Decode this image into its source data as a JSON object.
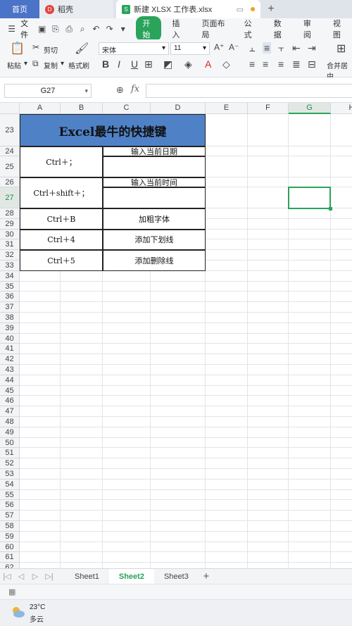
{
  "tabs": {
    "home": "首页",
    "docer": "稻壳",
    "file": "新建 XLSX 工作表.xlsx",
    "add_icon": "plus-icon"
  },
  "menu": {
    "file": "文件",
    "start": "开始",
    "items": [
      "插入",
      "页面布局",
      "公式",
      "数据",
      "审阅",
      "视图"
    ]
  },
  "ribbon": {
    "paste": "粘贴",
    "cut": "剪切",
    "copy": "复制",
    "format_painter": "格式刷",
    "font_name": "宋体",
    "font_size": "11",
    "merge": "合并居中"
  },
  "formula_bar": {
    "cell_ref": "G27",
    "fx": "fx",
    "value": ""
  },
  "columns": [
    "A",
    "B",
    "C",
    "D",
    "E",
    "F",
    "G",
    "H"
  ],
  "selected_column": "G",
  "selected_row": "27",
  "rows": [
    "23",
    "24",
    "25",
    "26",
    "27",
    "28",
    "29",
    "30",
    "31",
    "32",
    "33",
    "34",
    "35",
    "36",
    "37",
    "38",
    "39",
    "40",
    "41",
    "42",
    "43",
    "44",
    "45",
    "46",
    "47",
    "48",
    "49",
    "50",
    "51",
    "52",
    "53",
    "54",
    "55",
    "56",
    "57",
    "58",
    "59",
    "60",
    "61",
    "62"
  ],
  "table": {
    "title": "Excel最牛的快捷键",
    "entries": [
      {
        "key": "Ctrl＋；",
        "desc": "输入当前日期"
      },
      {
        "key": "Ctrl＋shift＋；",
        "desc": "输入当前时间"
      },
      {
        "key": "Ctrl＋B",
        "desc": "加粗字体"
      },
      {
        "key": "Ctrl＋4",
        "desc": "添加下划线"
      },
      {
        "key": "Ctrl＋5",
        "desc": "添加删除线"
      }
    ]
  },
  "sheets": [
    "Sheet1",
    "Sheet2",
    "Sheet3"
  ],
  "active_sheet": "Sheet2",
  "weather": {
    "temp": "23°C",
    "condition": "多云"
  },
  "colors": {
    "accent": "#2aa35b",
    "title_fill": "#4f81c7",
    "home_tab": "#4b73c7"
  }
}
